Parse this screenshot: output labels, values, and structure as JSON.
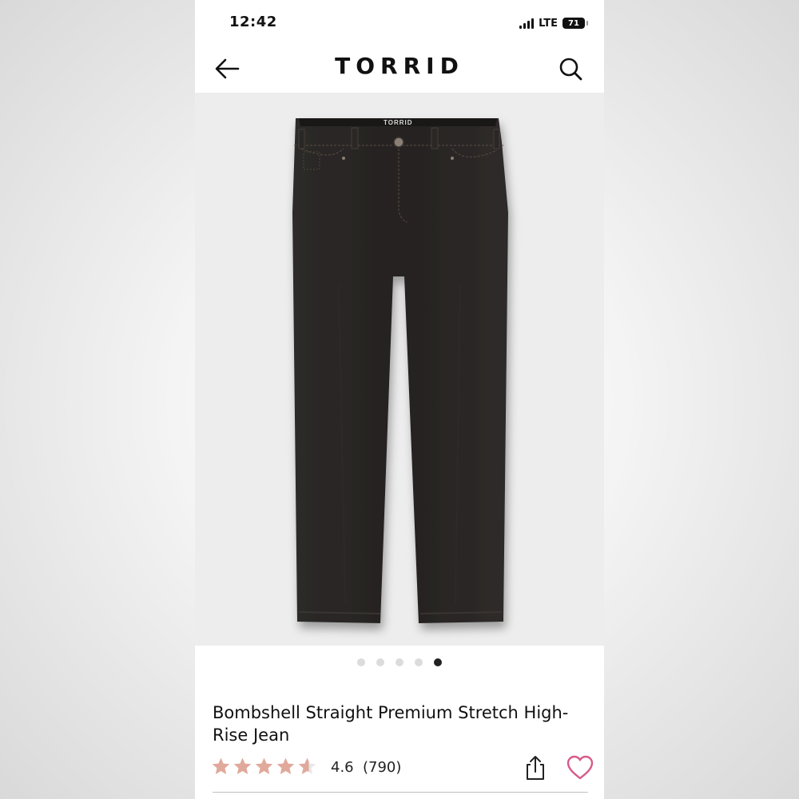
{
  "status_bar": {
    "time": "12:42",
    "network": "LTE",
    "battery": "71"
  },
  "header": {
    "brand": "TORRID",
    "back_icon": "arrow-left-icon",
    "search_icon": "search-icon"
  },
  "gallery": {
    "product_image": "black straight-leg jeans",
    "waistband_label": "TORRID",
    "slide_count": 5,
    "active_slide": 5
  },
  "product": {
    "title": "Bombshell Straight Premium Stretch High-Rise Jean",
    "rating": "4.6",
    "rating_value": 4.6,
    "review_count": "(790)",
    "share_icon": "share-icon",
    "favorite_icon": "heart-icon"
  },
  "colors": {
    "star": "#e0a99b",
    "star_empty": "#e8e8e8",
    "heart": "#d65b8a",
    "denim": "#2a2726"
  }
}
